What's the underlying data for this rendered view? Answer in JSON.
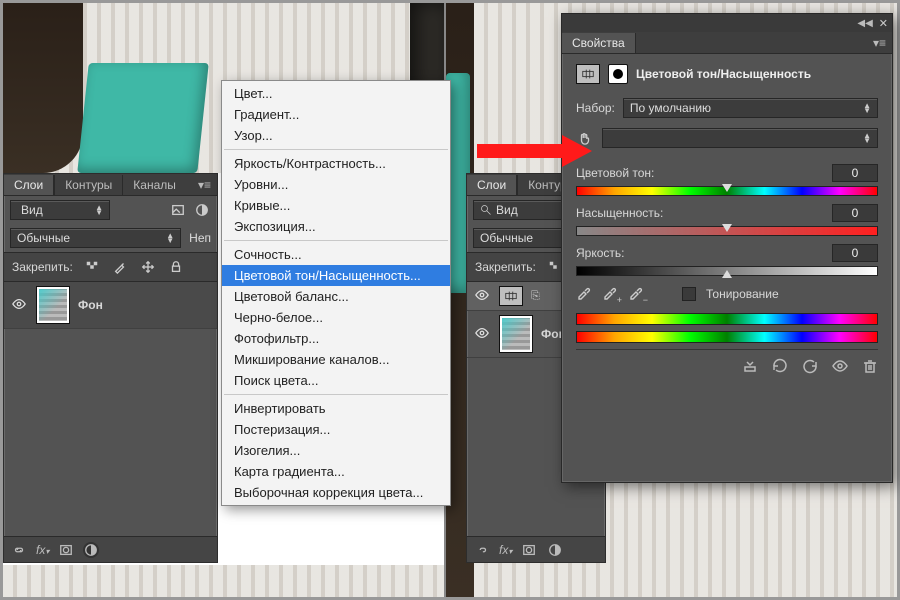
{
  "leftPanel": {
    "tabs": [
      "Слои",
      "Контуры",
      "Каналы"
    ],
    "activeTab": 0,
    "viewSelector": "Вид",
    "blendMode": "Обычные",
    "opacityLabelShort": "Неп",
    "lockLabel": "Закрепить:",
    "layerName": "Фон"
  },
  "menu": {
    "groups": [
      [
        "Цвет...",
        "Градиент...",
        "Узор..."
      ],
      [
        "Яркость/Контрастность...",
        "Уровни...",
        "Кривые...",
        "Экспозиция..."
      ],
      [
        "Сочность...",
        "Цветовой тон/Насыщенность...",
        "Цветовой баланс...",
        "Черно-белое...",
        "Фотофильтр...",
        "Микширование каналов...",
        "Поиск цвета..."
      ],
      [
        "Инвертировать",
        "Постеризация...",
        "Изогелия...",
        "Карта градиента...",
        "Выборочная коррекция цвета..."
      ]
    ],
    "highlighted": "Цветовой тон/Насыщенность..."
  },
  "rightPanel": {
    "tabs": [
      "Слои",
      "Контуры"
    ],
    "activeTab": 0,
    "viewSelector": "Вид",
    "blendMode": "Обычные",
    "lockLabel": "Закрепить:",
    "layer2Name": "Фон"
  },
  "properties": {
    "tabTitle": "Свойства",
    "title": "Цветовой тон/Насыщенность",
    "presetLabel": "Набор:",
    "presetValue": "По умолчанию",
    "channelValue": "",
    "hue": {
      "label": "Цветовой тон:",
      "value": "0"
    },
    "sat": {
      "label": "Насыщенность:",
      "value": "0"
    },
    "lig": {
      "label": "Яркость:",
      "value": "0"
    },
    "colorize": "Тонирование"
  }
}
